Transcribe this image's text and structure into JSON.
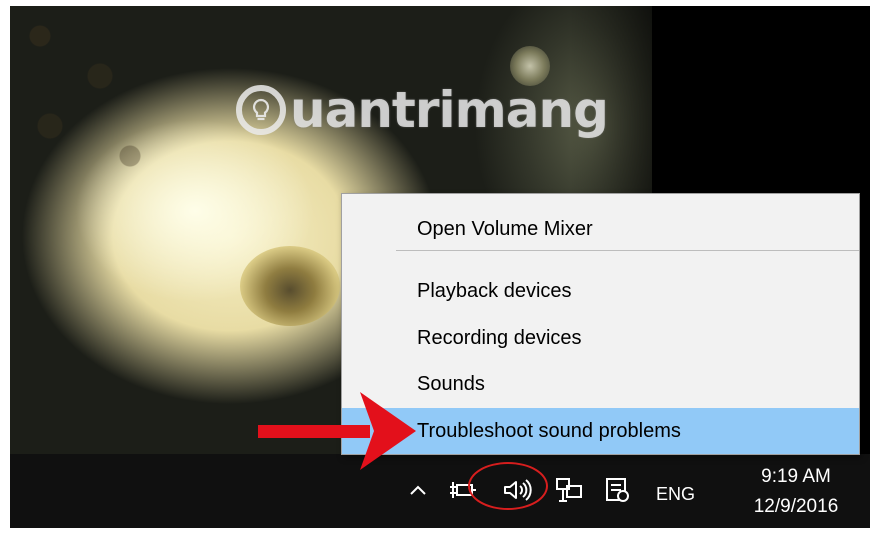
{
  "watermark": {
    "text": "uantrimang"
  },
  "context_menu": {
    "items": [
      {
        "label": "Open Volume Mixer"
      },
      {
        "label": "Playback devices"
      },
      {
        "label": "Recording devices"
      },
      {
        "label": "Sounds"
      },
      {
        "label": "Troubleshoot sound problems"
      }
    ],
    "highlighted_item": "Troubleshoot sound problems",
    "highlight_color": "#91c9f7"
  },
  "taskbar": {
    "tray_icons": [
      "chevron-up-icon",
      "power-plug-icon",
      "speaker-icon",
      "network-icon",
      "action-center-icon"
    ],
    "language": "ENG",
    "clock": {
      "time": "9:19 AM",
      "date": "12/9/2016"
    }
  },
  "annotations": {
    "arrow_color": "#e3101b",
    "ring_color": "#d81e1e"
  }
}
